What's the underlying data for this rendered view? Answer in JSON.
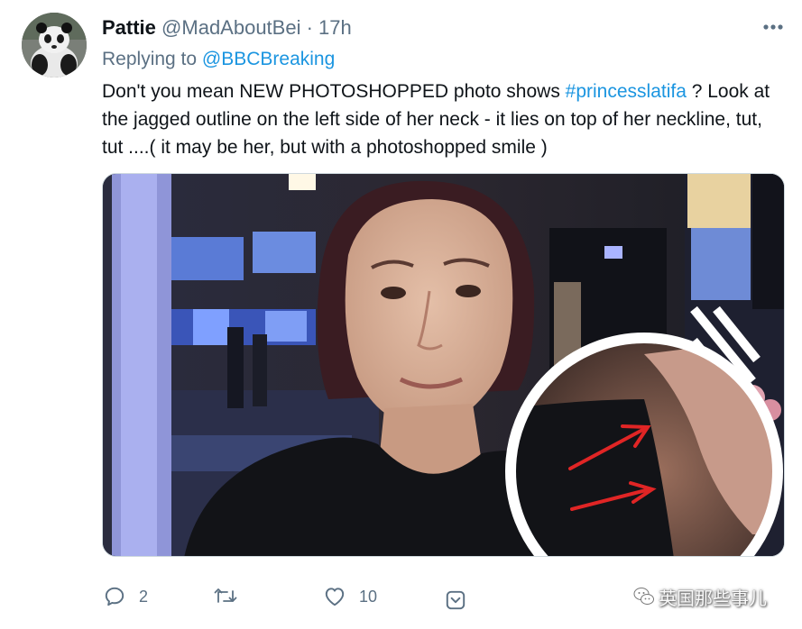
{
  "tweet": {
    "author_name": "Pattie",
    "author_handle": "@MadAboutBei",
    "separator": "·",
    "time": "17h",
    "reply_prefix": "Replying to",
    "reply_to": "@BBCBreaking",
    "text_part1": "Don't you mean NEW PHOTOSHOPPED photo shows ",
    "hashtag": "#princesslatifa",
    "text_part2": " ? Look at the jagged outline on the left side of her neck - it lies on top of her neckline,  tut, tut ....( it may be her, but with a photoshopped smile )"
  },
  "actions": {
    "reply_count": "2",
    "retweet_count": "",
    "like_count": "10"
  },
  "watermark": {
    "text": "英国那些事儿"
  },
  "colors": {
    "link": "#1b95e0",
    "secondary_text": "#5b7083",
    "annotation_arrow": "#e02525"
  },
  "icons": [
    "more-icon",
    "reply-icon",
    "retweet-icon",
    "like-icon",
    "share-icon",
    "wechat-icon"
  ]
}
